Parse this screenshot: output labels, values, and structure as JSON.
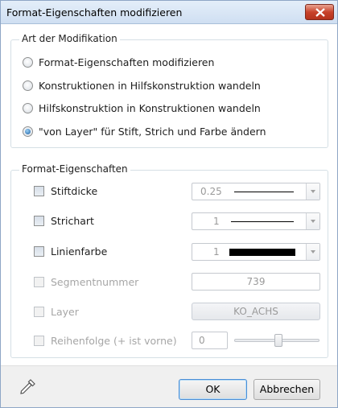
{
  "window": {
    "title": "Format-Eigenschaften modifizieren"
  },
  "modification": {
    "legend": "Art der Modifikation",
    "options": [
      {
        "label": "Format-Eigenschaften modifizieren",
        "checked": false
      },
      {
        "label": "Konstruktionen in Hilfskonstruktion wandeln",
        "checked": false
      },
      {
        "label": "Hilfskonstruktion in Konstruktionen wandeln",
        "checked": false
      },
      {
        "label": "\"von Layer\" für Stift, Strich und Farbe ändern",
        "checked": true
      }
    ]
  },
  "properties": {
    "legend": "Format-Eigenschaften",
    "stiftdicke": {
      "label": "Stiftdicke",
      "value": "0.25"
    },
    "strichart": {
      "label": "Strichart",
      "value": "1"
    },
    "linienfarbe": {
      "label": "Linienfarbe",
      "value": "1",
      "color": "#000000"
    },
    "segmentnummer": {
      "label": "Segmentnummer",
      "value": "739"
    },
    "layer": {
      "label": "Layer",
      "value": "KO_ACHS"
    },
    "reihenfolge": {
      "label": "Reihenfolge (+ ist vorne)",
      "value": "0"
    }
  },
  "footer": {
    "ok_label": "OK",
    "cancel_label": "Abbrechen"
  },
  "icons": {
    "close": "close-icon",
    "pipette": "pipette-icon"
  },
  "colors": {
    "accent": "#1a5ea3",
    "close_button": "#c8432b",
    "disabled_text": "#a6a6a6"
  }
}
